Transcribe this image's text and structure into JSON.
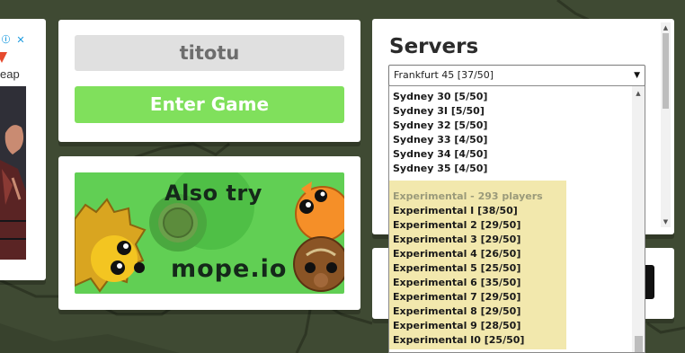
{
  "ad": {
    "choices_icon": "adchoices-icon",
    "close_icon": "close-icon",
    "text": "eap"
  },
  "login": {
    "nickname_value": "titotu",
    "enter_label": "Enter Game"
  },
  "promo": {
    "also_try": "Also try",
    "game_name": "mope.io"
  },
  "servers": {
    "title": "Servers",
    "selected": "Frankfurt 45 [37/50]",
    "dropdown_arrow": "▼",
    "options": [
      "Sydney 30 [5/50]",
      "Sydney 3I [5/50]",
      "Sydney 32 [5/50]",
      "Sydney 33 [4/50]",
      "Sydney 34 [4/50]",
      "Sydney 35 [4/50]"
    ],
    "group_label": "Experimental - 293 players",
    "group_options": [
      "Experimental I [38/50]",
      "Experimental 2 [29/50]",
      "Experimental 3 [29/50]",
      "Experimental 4 [26/50]",
      "Experimental 5 [25/50]",
      "Experimental 6 [35/50]",
      "Experimental 7 [29/50]",
      "Experimental 8 [29/50]",
      "Experimental 9 [28/50]",
      "Experimental I0 [25/50]"
    ]
  },
  "colors": {
    "background": "#3f4a33",
    "enter_button": "#80e05c",
    "promo_background": "#61cf54",
    "dropdown_highlight": "#f1e6a6"
  }
}
